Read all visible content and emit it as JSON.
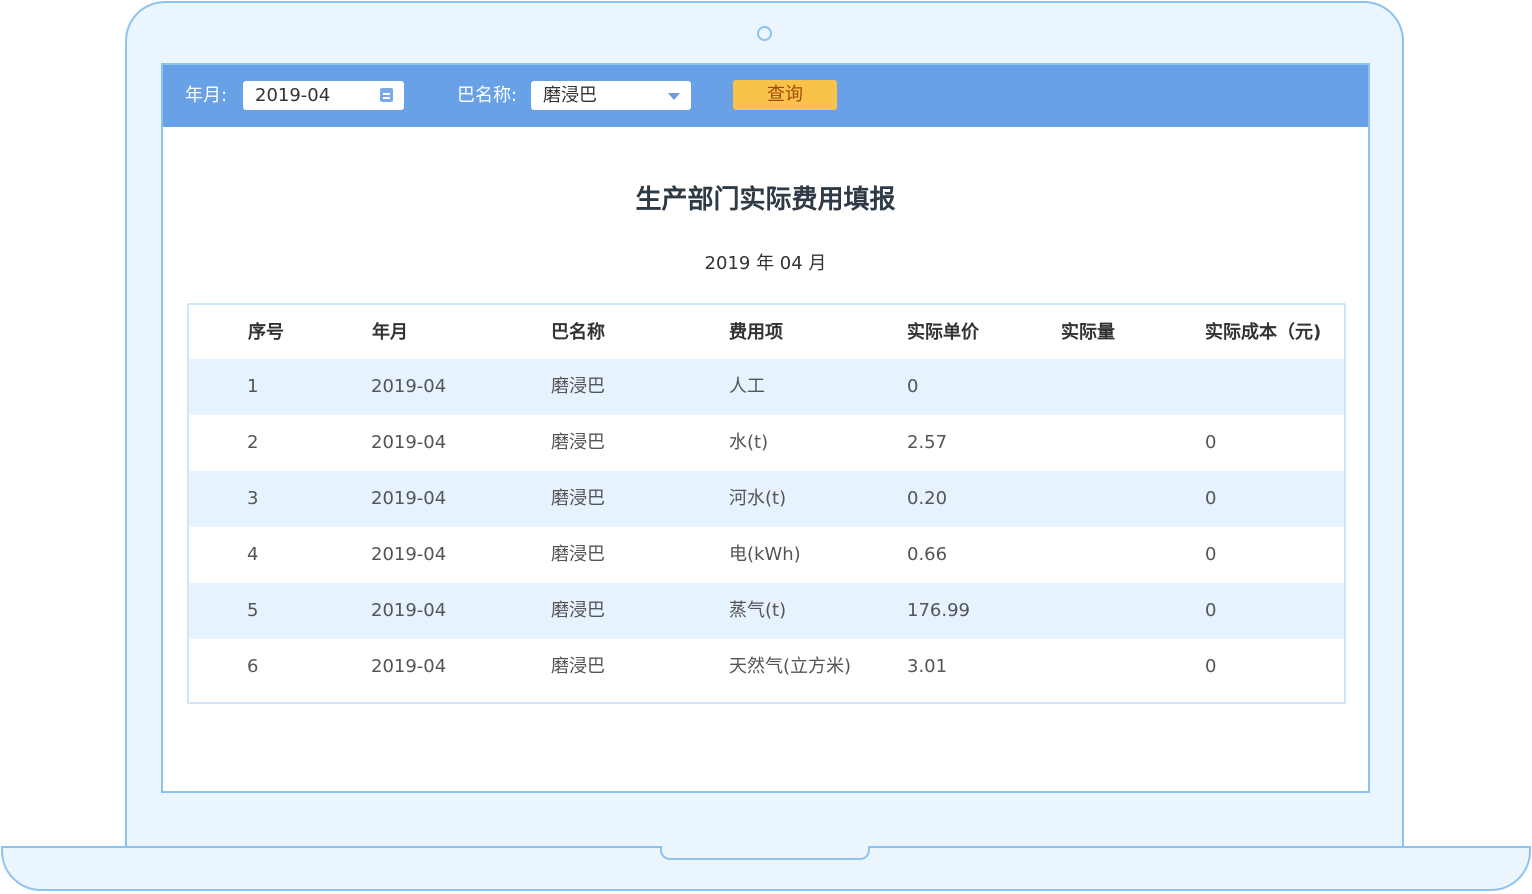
{
  "filters": {
    "month_label": "年月:",
    "month_value": "2019-04",
    "name_label": "巴名称:",
    "name_value": "磨浸巴",
    "query_label": "查询"
  },
  "report": {
    "title": "生产部门实际费用填报",
    "subtitle": "2019 年 04 月"
  },
  "table": {
    "columns": [
      "序号",
      "年月",
      "巴名称",
      "费用项",
      "实际单价",
      "实际量",
      "实际成本（元)"
    ],
    "rows": [
      [
        "1",
        "2019-04",
        "磨浸巴",
        "人工",
        "0",
        "",
        ""
      ],
      [
        "2",
        "2019-04",
        "磨浸巴",
        "水(t)",
        "2.57",
        "",
        "0"
      ],
      [
        "3",
        "2019-04",
        "磨浸巴",
        "河水(t)",
        "0.20",
        "",
        "0"
      ],
      [
        "4",
        "2019-04",
        "磨浸巴",
        "电(kWh)",
        "0.66",
        "",
        "0"
      ],
      [
        "5",
        "2019-04",
        "磨浸巴",
        "蒸气(t)",
        "176.99",
        "",
        "0"
      ],
      [
        "6",
        "2019-04",
        "磨浸巴",
        "天然气(立方米)",
        "3.01",
        "",
        "0"
      ]
    ]
  },
  "colors": {
    "toolbar": "#68a1e6",
    "button": "#f8c348",
    "row_alt": "#e6f2fd",
    "frame": "#8ec2ee"
  },
  "icons": [
    "camera-icon",
    "calendar-icon",
    "dropdown-caret-icon"
  ]
}
